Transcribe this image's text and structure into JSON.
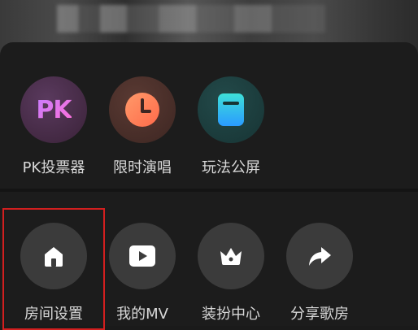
{
  "top_row": [
    {
      "label": "PK投票器",
      "icon": "pk-icon"
    },
    {
      "label": "限时演唱",
      "icon": "timer-icon"
    },
    {
      "label": "玩法公屏",
      "icon": "screen-icon"
    }
  ],
  "bottom_row": [
    {
      "label": "房间设置",
      "icon": "home-icon"
    },
    {
      "label": "我的MV",
      "icon": "play-icon"
    },
    {
      "label": "装扮中心",
      "icon": "crown-icon"
    },
    {
      "label": "分享歌房",
      "icon": "share-icon"
    }
  ],
  "pk_icon_text": "PK",
  "colors": {
    "panel": "#1c1c1c",
    "highlight": "#d21f1f",
    "label": "#d8d8d8",
    "icon_circle": "#3b3b3b"
  }
}
